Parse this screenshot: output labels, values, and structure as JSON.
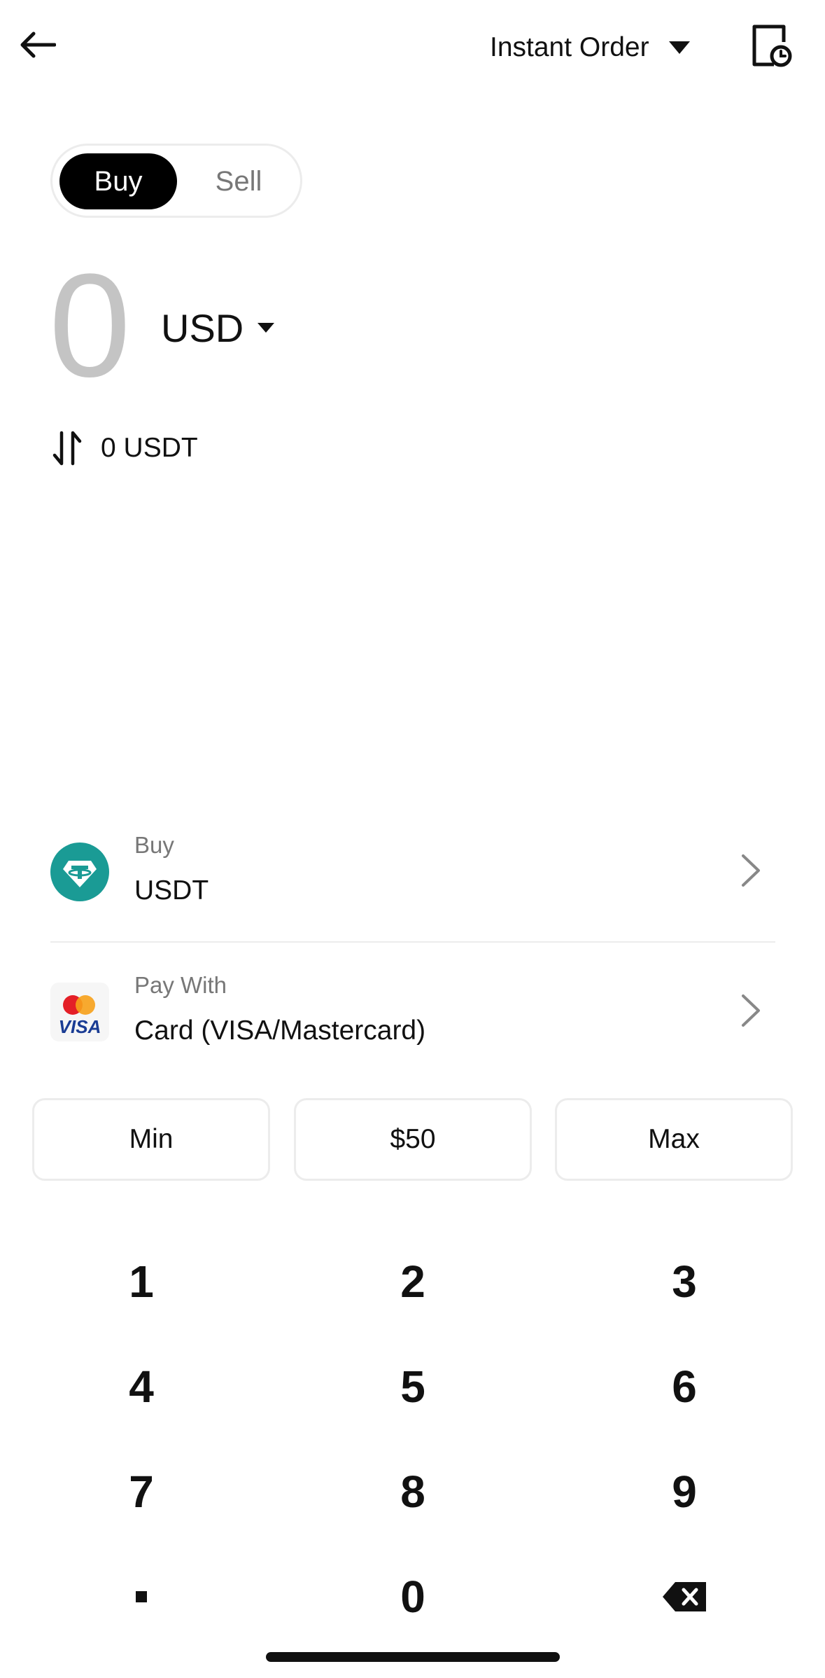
{
  "header": {
    "back_icon": "arrow-left-icon",
    "order_type_label": "Instant Order",
    "order_type_icon": "caret-down-icon",
    "history_icon": "order-history-icon"
  },
  "toggle": {
    "buy_label": "Buy",
    "sell_label": "Sell",
    "selected": "Buy"
  },
  "amount": {
    "value": "0",
    "currency": "USD"
  },
  "conversion": {
    "icon": "swap-vertical-icon",
    "text": "0 USDT"
  },
  "asset_row": {
    "sub_label": "Buy",
    "value": "USDT",
    "icon": "tether-icon",
    "brand_color": "#1a9b95"
  },
  "payment_row": {
    "sub_label": "Pay With",
    "value": "Card (VISA/Mastercard)",
    "icon": "visa-mastercard-icon"
  },
  "quick_amounts": [
    "Min",
    "$50",
    "Max"
  ],
  "keypad": [
    "1",
    "2",
    "3",
    "4",
    "5",
    "6",
    "7",
    "8",
    "9",
    ".",
    "0",
    "backspace"
  ],
  "colors": {
    "accent": "#000000",
    "muted_text": "#777777",
    "amount_placeholder": "#c4c4c4",
    "border": "#ececec"
  }
}
